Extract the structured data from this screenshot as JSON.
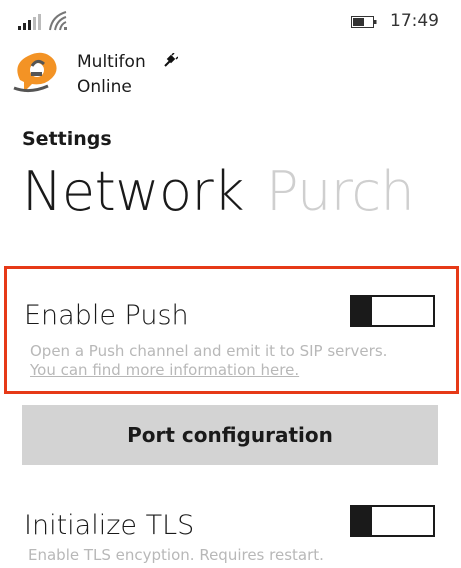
{
  "status_bar": {
    "time": "17:49",
    "icons": [
      "signal-icon",
      "wifi-icon",
      "battery-icon"
    ]
  },
  "app": {
    "name_line1": "Multifon",
    "name_line2": "Online",
    "logo_icon": "multifon-logo-icon",
    "status_icon": "plug-icon"
  },
  "settings_label": "Settings",
  "pivot": {
    "active": "Network",
    "next": "Purch"
  },
  "enable_push": {
    "title": "Enable Push",
    "description": "Open a Push channel and emit it to SIP servers.",
    "link": "You can find more information here.",
    "enabled": false
  },
  "port_button": {
    "label": "Port configuration"
  },
  "initialize_tls": {
    "title": "Initialize TLS",
    "description": "Enable TLS encyption. Requires restart.",
    "enabled": false
  },
  "colors": {
    "highlight": "#e63917",
    "button_bg": "#d3d3d3",
    "inactive_pivot": "#cfcfcf"
  }
}
